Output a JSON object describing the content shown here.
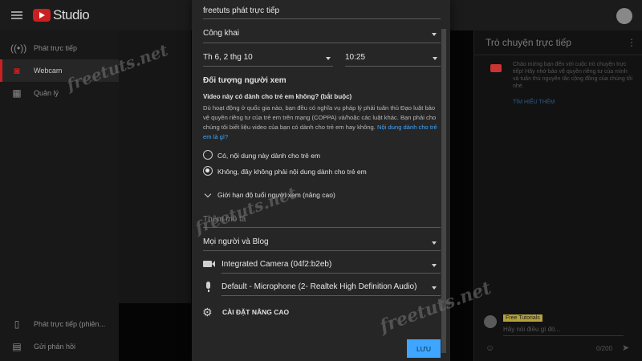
{
  "topbar": {
    "studio_text": "Studio"
  },
  "sidebar": {
    "items": [
      {
        "label": "Phát trực tiếp",
        "icon": "broadcast-icon",
        "active": false
      },
      {
        "label": "Webcam",
        "icon": "camera-icon",
        "active": true
      },
      {
        "label": "Quản lý",
        "icon": "calendar-icon",
        "active": false
      }
    ],
    "bottom_items": [
      {
        "label": "Phát trực tiếp (phiên...",
        "icon": "phone-stream-icon"
      },
      {
        "label": "Gửi phản hồi",
        "icon": "feedback-icon"
      }
    ]
  },
  "chat": {
    "title": "Trò chuyện trực tiếp",
    "notice": "Chào mừng bạn đến với cuộc trò chuyện trực tiếp! Hãy nhớ bảo vệ quyền riêng tư của mình và tuân thủ nguyên tắc cộng đồng của chúng tôi nhé.",
    "learn_more": "TÌM HIỂU THÊM",
    "user_name": "Free Tutorials",
    "input_placeholder": "Hãy nói điều gì đó...",
    "counter": "0/200"
  },
  "form": {
    "title": "freetuts phát trực tiếp",
    "visibility": "Công khai",
    "date": "Th 6, 2 thg 10",
    "time": "10:25",
    "audience_heading": "Đối tượng người xem",
    "kids_question": "Video này có dành cho trẻ em không? (bắt buộc)",
    "kids_desc": "Dù hoạt động ở quốc gia nào, bạn đều có nghĩa vụ pháp lý phải tuân thủ Đạo luật bảo vệ quyền riêng tư của trẻ em trên mạng (COPPA) và/hoặc các luật khác. Bạn phải cho chúng tôi biết liệu video của bạn có dành cho trẻ em hay không.",
    "kids_link": "Nội dung dành cho trẻ em là gì?",
    "radio_yes": "Có, nội dung này dành cho trẻ em",
    "radio_no": "Không, đây không phải nội dung dành cho trẻ em",
    "selected_radio": "no",
    "age_restriction": "Giới hạn độ tuổi người xem (nâng cao)",
    "description_placeholder": "Thêm mô tả",
    "category": "Mọi người và Blog",
    "camera": "Integrated Camera (04f2:b2eb)",
    "microphone": "Default - Microphone (2- Realtek High Definition Audio)",
    "advanced_settings": "CÀI ĐẶT NÂNG CAO",
    "save_label": "LƯU"
  },
  "watermark": "freetuts.net",
  "colors": {
    "accent": "#3ea6ff",
    "brand_red": "#cc1f1f",
    "modal_bg": "#262626"
  }
}
